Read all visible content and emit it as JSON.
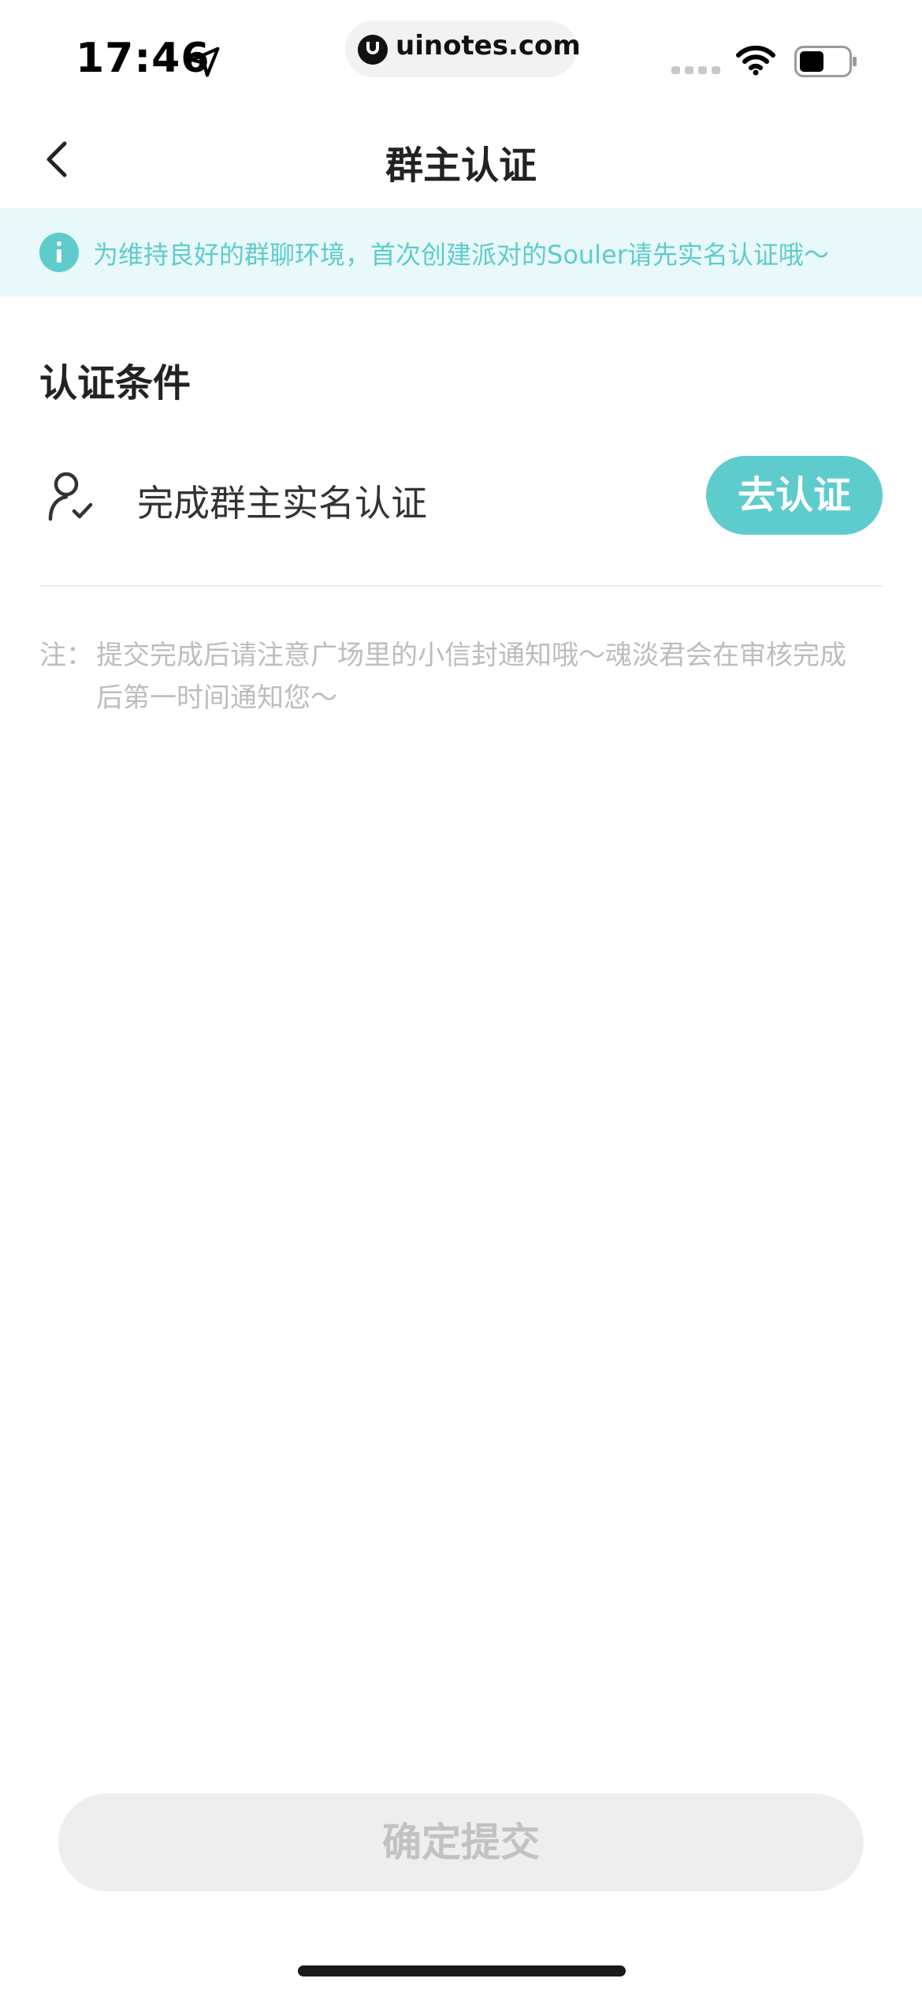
{
  "status_bar": {
    "time": "17:46",
    "url": "uinotes.com",
    "icons": [
      "location-arrow-icon",
      "signal-icon",
      "wifi-icon",
      "battery-icon"
    ]
  },
  "nav": {
    "title": "群主认证",
    "back_icon": "chevron-left-icon"
  },
  "notice": {
    "icon": "info-icon",
    "text": "为维持良好的群聊环境，首次创建派对的Souler请先实名认证哦～"
  },
  "conditions": {
    "title": "认证条件",
    "items": [
      {
        "icon": "user-check-icon",
        "label": "完成群主实名认证",
        "action_label": "去认证"
      }
    ]
  },
  "note": {
    "prefix": "注：",
    "text": "提交完成后请注意广场里的小信封通知哦～魂淡君会在审核完成后第一时间通知您～"
  },
  "submit": {
    "label": "确定提交"
  },
  "colors": {
    "accent": "#5ECCCC",
    "banner_bg": "#E9F8F8",
    "disabled_bg": "#EEEEEE",
    "disabled_text": "#C2C2C2",
    "note_text": "#BDBDBD"
  }
}
